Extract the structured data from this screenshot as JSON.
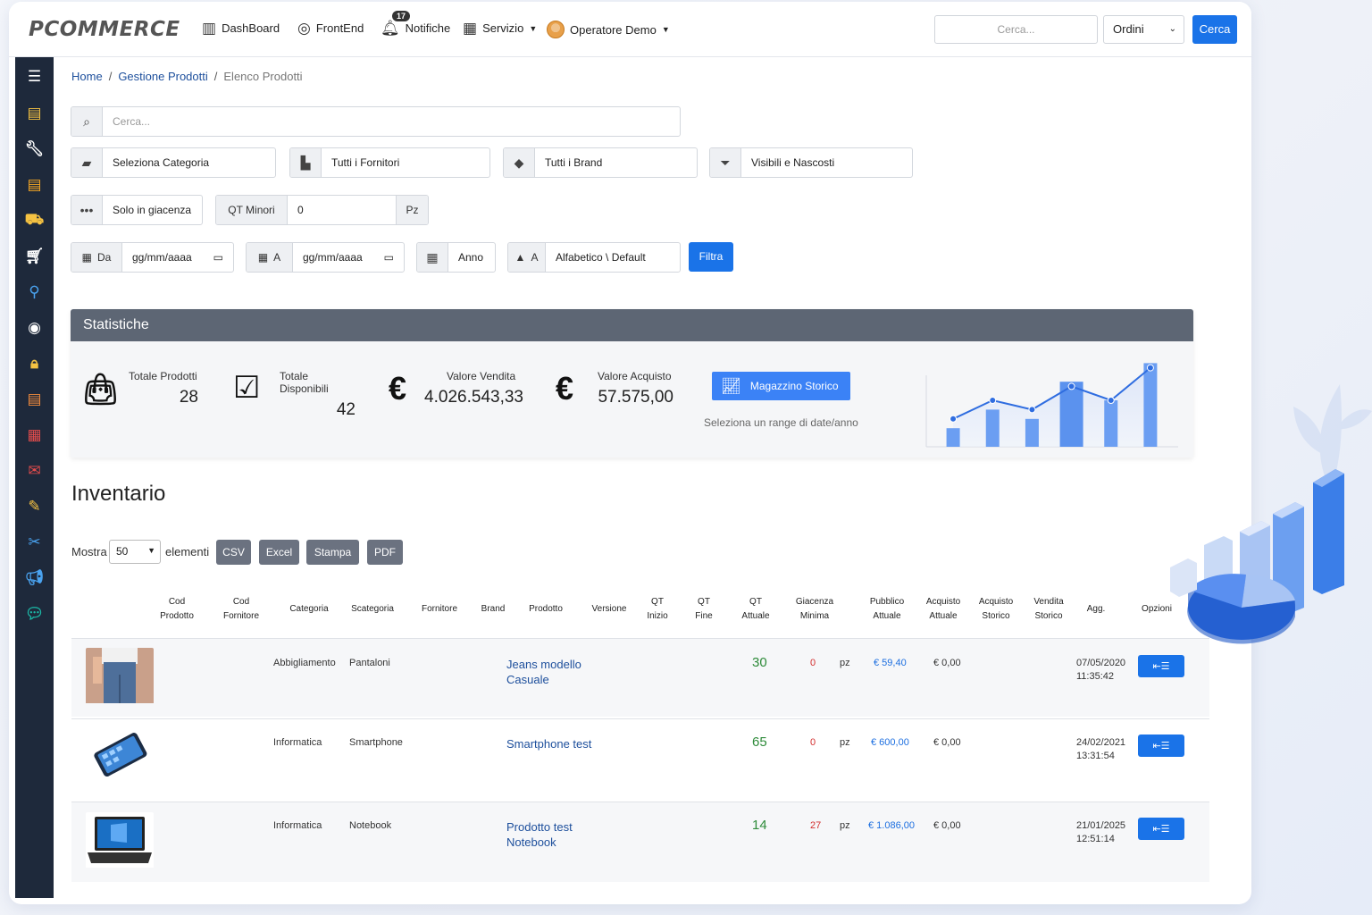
{
  "header": {
    "brand": "PCOMMERCE",
    "nav": {
      "dashboard": "DashBoard",
      "frontend": "FrontEnd",
      "notifiche": "Notifiche",
      "notifiche_count": "17",
      "servizio": "Servizio",
      "operatore": "Operatore Demo"
    },
    "search_placeholder": "Cerca...",
    "search_scope": "Ordini",
    "search_button": "Cerca"
  },
  "sidebar": {
    "icons": [
      "menu-icon",
      "store-icon",
      "wrench-icon",
      "document-icon",
      "truck-icon",
      "basket-icon",
      "map-pin-icon",
      "target-icon",
      "lock-icon",
      "file-icon",
      "grid-icon",
      "mail-icon",
      "pencil-icon",
      "scissors-icon",
      "megaphone-icon",
      "chat-icon"
    ],
    "colors": [
      "#ffffff",
      "#f5c242",
      "#ffffff",
      "#f5a623",
      "#f5c242",
      "#ffffff",
      "#4aa3f0",
      "#ffffff",
      "#f5c242",
      "#f08a3c",
      "#e44c4c",
      "#e44c4c",
      "#f5c242",
      "#4aa3f0",
      "#4aa3f0",
      "#1bb8a6"
    ]
  },
  "breadcrumb": {
    "home": "Home",
    "section": "Gestione Prodotti",
    "current": "Elenco Prodotti"
  },
  "filters": {
    "search_placeholder": "Cerca...",
    "categoria": "Seleziona Categoria",
    "fornitori": "Tutti i Fornitori",
    "brand": "Tutti i Brand",
    "visibilita": "Visibili e Nascosti",
    "giacenza": "Solo in giacenza",
    "qt_minori_label": "QT Minori",
    "qt_minori_value": "0",
    "qt_unit": "Pz",
    "da_label": "Da",
    "a_label": "A",
    "date_placeholder": "gg/mm/aaaa",
    "anno": "Anno",
    "sort_label": "A",
    "sort_value": "Alfabetico \\ Default",
    "filter_button": "Filtra"
  },
  "stats": {
    "title": "Statistiche",
    "totale_prodotti_label": "Totale Prodotti",
    "totale_prodotti": "28",
    "totale_disponibili_label": "Totale Disponibili",
    "totale_disponibili": "42",
    "valore_vendita_label": "Valore Vendita",
    "valore_vendita": "4.026.543,33",
    "valore_acquisto_label": "Valore Acquisto",
    "valore_acquisto": "57.575,00",
    "storico_button": "Magazzino Storico",
    "hint": "Seleziona un range di date/anno",
    "euro_symbol": "€"
  },
  "inventory": {
    "title": "Inventario",
    "mostra": "Mostra",
    "page_size": "50",
    "elementi": "elementi",
    "exports": [
      "CSV",
      "Excel",
      "Stampa",
      "PDF"
    ],
    "columns": [
      [
        "Cod",
        "Prodotto"
      ],
      [
        "Cod",
        "Fornitore"
      ],
      [
        "Categoria"
      ],
      [
        "Scategoria"
      ],
      [
        "Fornitore"
      ],
      [
        "Brand"
      ],
      [
        "Prodotto"
      ],
      [
        "Versione"
      ],
      [
        "QT",
        "Inizio"
      ],
      [
        "QT",
        "Fine"
      ],
      [
        "QT",
        "Attuale"
      ],
      [
        "Giacenza",
        "Minima"
      ],
      [
        "Pubblico",
        "Attuale"
      ],
      [
        "Acquisto",
        "Attuale"
      ],
      [
        "Acquisto",
        "Storico"
      ],
      [
        "Vendita",
        "Storico"
      ],
      [
        "Agg."
      ],
      [
        "Opzioni"
      ]
    ],
    "rows": [
      {
        "categoria": "Abbigliamento",
        "scategoria": "Pantaloni",
        "prodotto": [
          "Jeans modello",
          "Casuale"
        ],
        "qt_attuale": "30",
        "giacenza_minima": "0",
        "unit": "pz",
        "pubblico": "€ 59,40",
        "acquisto": "€ 0,00",
        "agg": [
          "07/05/2020",
          "11:35:42"
        ],
        "thumb": "jeans"
      },
      {
        "categoria": "Informatica",
        "scategoria": "Smartphone",
        "prodotto": [
          "Smartphone test",
          ""
        ],
        "qt_attuale": "65",
        "giacenza_minima": "0",
        "unit": "pz",
        "pubblico": "€ 600,00",
        "acquisto": "€ 0,00",
        "agg": [
          "24/02/2021",
          "13:31:54"
        ],
        "thumb": "phone"
      },
      {
        "categoria": "Informatica",
        "scategoria": "Notebook",
        "prodotto": [
          "Prodotto test",
          "Notebook"
        ],
        "qt_attuale": "14",
        "giacenza_minima": "27",
        "unit": "pz",
        "pubblico": "€ 1.086,00",
        "acquisto": "€ 0,00",
        "agg": [
          "21/01/2025",
          "12:51:14"
        ],
        "thumb": "laptop"
      }
    ]
  },
  "chart_data": {
    "type": "bar",
    "categories": [
      "1",
      "2",
      "3",
      "4",
      "5",
      "6"
    ],
    "series": [
      {
        "values": [
          2,
          4,
          3,
          7,
          5,
          9
        ]
      },
      {
        "values": [
          3,
          5,
          4,
          6.5,
          5,
          8.5
        ]
      }
    ],
    "title": "",
    "xlabel": "",
    "ylabel": "",
    "ylim": [
      0,
      10
    ]
  }
}
